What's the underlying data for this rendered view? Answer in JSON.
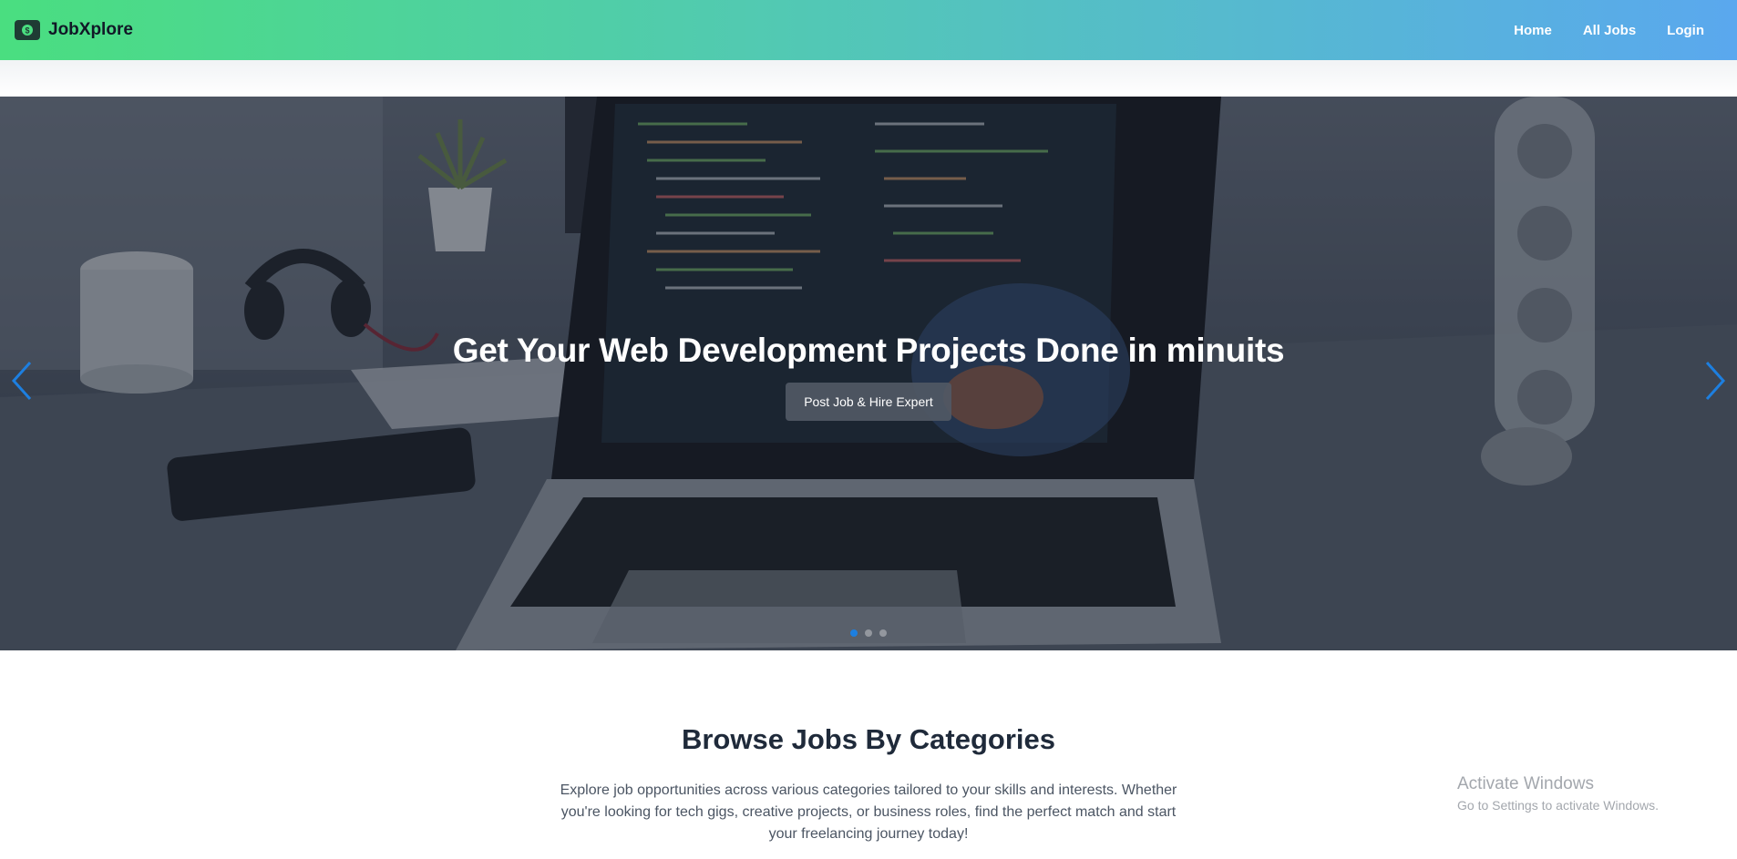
{
  "navbar": {
    "brand_name": "JobXplore",
    "links": [
      {
        "label": "Home"
      },
      {
        "label": "All Jobs"
      },
      {
        "label": "Login"
      }
    ]
  },
  "hero": {
    "title": "Get Your Web Development Projects Done in minuits",
    "button_label": "Post Job & Hire Expert",
    "slide_count": 3,
    "active_slide": 1
  },
  "categories": {
    "title": "Browse Jobs By Categories",
    "description": "Explore job opportunities across various categories tailored to your skills and interests. Whether you're looking for tech gigs, creative projects, or business roles, find the perfect match and start your freelancing journey today!"
  },
  "watermark": {
    "title": "Activate Windows",
    "subtitle": "Go to Settings to activate Windows."
  },
  "colors": {
    "nav_gradient_start": "#4ade80",
    "nav_gradient_end": "#5aa8ee",
    "accent_blue": "#1d7fe0",
    "heading": "#1f2a3a"
  },
  "icons": [
    "logo-icon",
    "chevron-left-icon",
    "chevron-right-icon"
  ]
}
